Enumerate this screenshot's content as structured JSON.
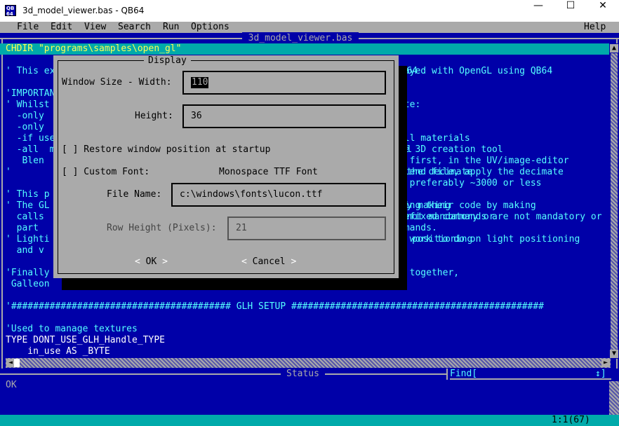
{
  "window": {
    "title": "3d_model_viewer.bas - QB64",
    "minimize": "—",
    "maximize": "☐",
    "close": "✕"
  },
  "menu": {
    "file": "File",
    "edit": "Edit",
    "view": "View",
    "search": "Search",
    "run": "Run",
    "options": "Options",
    "help": "Help"
  },
  "editor": {
    "file_tab": "3d_model_viewer.bas",
    "lines": [
      {
        "text": "CHDIR \"programs\\samples\\open_gl\"",
        "style": "sel"
      },
      {
        "text": "",
        "style": "c"
      },
      {
        "text": "' This example shows how a 3D model can be displayed with OpenGL using QB64",
        "style": "c"
      },
      {
        "text": "",
        "style": "c"
      },
      {
        "text": "'IMPORTANT:",
        "style": "c"
      },
      {
        "text": "' Whilst the code is functional, it is incomplete:",
        "style": "c"
      },
      {
        "text": "  -only",
        "style": "c"
      },
      {
        "text": "  -only",
        "style": "c"
      },
      {
        "text": "  -if uses textures, then materials will not work, use all materials",
        "style": "c"
      },
      {
        "text": "  -all  models must be created and exported from the free 3D creation tool",
        "style": "c"
      },
      {
        "text": "   Blen  and textures must be applied at first, in the UV/image-editor",
        "style": "c"
      },
      {
        "text": "'        after loading the model in blender, from the .blend file, apply the decimate",
        "style": "c"
      },
      {
        "text": "                 the polygon count, preferably ~3000 or less",
        "style": "c"
      },
      {
        "text": "' This p",
        "style": "c"
      },
      {
        "text": "' The GL  users familiar with C++ can adjust to, by touching their code by making",
        "style": "c"
      },
      {
        "text": "  calls  with _gl prefixed commands. Note that _GL-prefixed commands are not mandatory or",
        "style": "c"
      },
      {
        "text": "  part   of QB64 commands, and are simply the OpenGL commands.",
        "style": "c"
      },
      {
        "text": "' Lighti  ng was added, but there is a lot of further work to do on light positioning",
        "style": "c"
      },
      {
        "text": "  and v",
        "style": "c"
      },
      {
        "text": "",
        "style": "c"
      },
      {
        "text": "'Finally  a big thanks to all who helped put this project together,",
        "style": "c"
      },
      {
        "text": " Galleon",
        "style": "c"
      },
      {
        "text": "",
        "style": "c"
      },
      {
        "text": "'######################################## GLH SETUP ##############################################",
        "style": "c"
      },
      {
        "text": "",
        "style": "c"
      },
      {
        "text": "'Used to manage textures",
        "style": "c"
      },
      {
        "text": "TYPE DONT_USE_GLH_Handle_TYPE",
        "style": "w"
      },
      {
        "text": "    in_use AS _BYTE",
        "style": "w"
      }
    ],
    "right_fragments": [
      {
        "row": 2,
        "text": "layed with OpenGL using QB64"
      },
      {
        "row": 5,
        "text": "ete:"
      },
      {
        "row": 8,
        "text": "all materials"
      },
      {
        "row": 9,
        "text": "ee 3D creation tool"
      },
      {
        "row": 10,
        "text": "t first, in the UV/image-editor"
      },
      {
        "row": 11,
        "text": "blend file, apply the decimate"
      },
      {
        "row": 12,
        "text": ", preferably ~3000 or less"
      },
      {
        "row": 14,
        "text": "hing their code by making"
      },
      {
        "row": 15,
        "text": "refixed commands are not mandatory or"
      },
      {
        "row": 16,
        "text": "mmands."
      },
      {
        "row": 17,
        "text": "e work to do on light positioning"
      },
      {
        "row": 20,
        "text": "t together,"
      }
    ]
  },
  "status": {
    "label": "Status",
    "find_label": "Find[",
    "find_arrows": "↕]",
    "message": "OK",
    "position": "1:1(67)"
  },
  "dialog": {
    "title": "Display",
    "width_label": "Window Size - Width:",
    "width_value": "110",
    "height_label": "Height:",
    "height_value": "36",
    "restore_checkbox": "[ ] Restore window position at startup",
    "custom_font_checkbox": "[ ] Custom Font:",
    "font_type": "Monospace TTF Font",
    "file_name_label": "File Name:",
    "file_name_value": "c:\\windows\\fonts\\lucon.ttf",
    "row_height_label": "Row Height (Pixels):",
    "row_height_value": "21",
    "ok": "OK",
    "cancel": "Cancel"
  },
  "colors": {
    "editor_bg": "#0000a8",
    "comment": "#55ffff",
    "keyword": "#ffffff",
    "dialog_bg": "#aaaaaa",
    "bottom_bar": "#00aaaa"
  }
}
